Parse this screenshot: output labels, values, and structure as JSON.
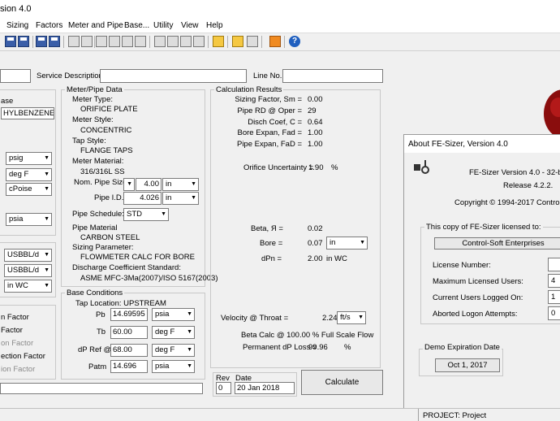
{
  "window": {
    "title": "sion 4.0"
  },
  "menu": [
    "Sizing",
    "Factors",
    "Meter and Pipe",
    "Base...",
    "Utility",
    "View",
    "Help"
  ],
  "header": {
    "service_label": "Service Description:",
    "line_label": "Line No.:"
  },
  "left": {
    "base_label": "ase",
    "fluid": "HYLBENZENE (li",
    "units1": [
      "psig",
      "deg F",
      "cPoise",
      "psia"
    ],
    "units2": [
      "USBBL/d",
      "USBBL/d",
      "in WC"
    ],
    "factors": [
      "n Factor",
      "Factor",
      "on Factor",
      "ection Factor",
      "ion Factor"
    ]
  },
  "meter": {
    "group_label": "Meter/Pipe Data",
    "meter_type_label": "Meter Type:",
    "meter_type": "ORIFICE PLATE",
    "meter_style_label": "Meter Style:",
    "meter_style": "CONCENTRIC",
    "tap_style_label": "Tap Style:",
    "tap_style": "FLANGE TAPS",
    "meter_material_label": "Meter Material:",
    "meter_material": "316/316L SS",
    "nom_size_label": "Nom. Pipe Size",
    "nom_size": "4.00",
    "nom_size_unit": "in",
    "pipe_id_label": "Pipe I.D.",
    "pipe_id": "4.026",
    "pipe_id_unit": "in",
    "schedule_label": "Pipe Schedule:",
    "schedule": "STD",
    "pipe_material_label": "Pipe Material",
    "pipe_material": "CARBON STEEL",
    "sizing_param_label": "Sizing Parameter:",
    "sizing_param": "FLOWMETER CALC FOR BORE",
    "discharge_label": "Discharge Coefficient Standard:",
    "discharge": "ASME MFC-3Ma(2007)/ISO 5167(2003)"
  },
  "base": {
    "group_label": "Base Conditions",
    "tap_location": "Tap Location:  UPSTREAM",
    "rows": [
      {
        "label": "Pb",
        "value": "14.69595",
        "unit": "psia"
      },
      {
        "label": "Tb",
        "value": "60.00",
        "unit": "deg F"
      },
      {
        "label": "dP Ref @",
        "value": "68.00",
        "unit": "deg F"
      },
      {
        "label": "Patm",
        "value": "14.696",
        "unit": "psia"
      }
    ]
  },
  "calc": {
    "group_label": "Calculation Results",
    "rows": [
      {
        "label": "Sizing Factor, Sm =",
        "value": "0.00"
      },
      {
        "label": "Pipe RD @ Oper =",
        "value": "29"
      },
      {
        "label": "Disch Coef, C =",
        "value": "0.64"
      },
      {
        "label": "Bore Expan, Fad =",
        "value": "1.00"
      },
      {
        "label": "Pipe Expan, FaD =",
        "value": "1.00"
      }
    ],
    "uncertainty_label": "Orifice Uncertainty =",
    "uncertainty": "1.90",
    "uncertainty_unit": "%",
    "beta_label": "Beta, Я =",
    "beta": "0.02",
    "bore_label": "Bore =",
    "bore": "0.07",
    "bore_unit": "in",
    "dpn_label": "dPn =",
    "dpn": "2.00",
    "dpn_unit": "in WC",
    "velocity_label": "Velocity @ Throat =",
    "velocity": "2.24",
    "velocity_unit": "ft/s",
    "beta_calc": "Beta Calc @  100.00   % Full Scale Flow",
    "perm_label": "Permanent dP Loss =",
    "perm": "99.96",
    "perm_unit": "%"
  },
  "footer": {
    "rev_label": "Rev",
    "rev": "0",
    "date_label": "Date",
    "date": "20 Jan 2018",
    "calculate": "Calculate"
  },
  "about": {
    "title": "About FE-Sizer, Version 4.0",
    "version": "FE-Sizer Version 4.0 - 32-bit ap",
    "release": "Release 4.2.2.",
    "copyright": "Copyright © 1994-2017 Control-Soft",
    "licensed_label": "This copy of FE-Sizer licensed to:",
    "licensee": "Control-Soft Enterprises",
    "license_number_label": "License Number:",
    "max_users_label": "Maximum Licensed Users:",
    "max_users": "4",
    "current_users_label": "Current Users Logged On:",
    "current_users": "1",
    "aborted_label": "Aborted Logon Attempts:",
    "aborted": "0",
    "demo_label": "Demo Expiration Date",
    "demo_date": "Oct 1, 2017"
  },
  "status": {
    "project": "PROJECT:  Project"
  }
}
